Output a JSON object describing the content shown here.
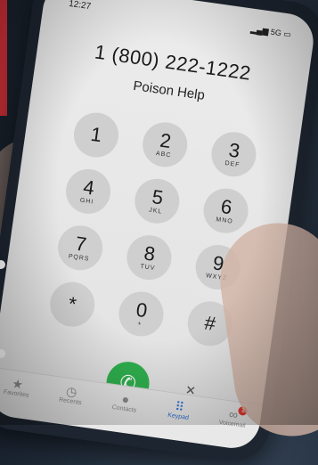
{
  "status": {
    "time": "12:27",
    "signal": "5G"
  },
  "dialer": {
    "number": "1 (800) 222-1222",
    "contact": "Poison Help",
    "keys": [
      {
        "digit": "1",
        "letters": ""
      },
      {
        "digit": "2",
        "letters": "ABC"
      },
      {
        "digit": "3",
        "letters": "DEF"
      },
      {
        "digit": "4",
        "letters": "GHI"
      },
      {
        "digit": "5",
        "letters": "JKL"
      },
      {
        "digit": "6",
        "letters": "MNO"
      },
      {
        "digit": "7",
        "letters": "PQRS"
      },
      {
        "digit": "8",
        "letters": "TUV"
      },
      {
        "digit": "9",
        "letters": "WXYZ"
      },
      {
        "digit": "*",
        "letters": ""
      },
      {
        "digit": "0",
        "letters": "+"
      },
      {
        "digit": "#",
        "letters": ""
      }
    ],
    "call_glyph": "✆",
    "delete_glyph": "✕"
  },
  "tabs": [
    {
      "label": "Favorites",
      "icon": "star-icon",
      "glyph": "★"
    },
    {
      "label": "Recents",
      "icon": "clock-icon",
      "glyph": "◷"
    },
    {
      "label": "Contacts",
      "icon": "person-icon",
      "glyph": "●"
    },
    {
      "label": "Keypad",
      "icon": "keypad-icon",
      "glyph": "⠿",
      "active": true
    },
    {
      "label": "Voicemail",
      "icon": "voicemail-icon",
      "glyph": "∞",
      "badge": "1"
    }
  ],
  "colors": {
    "accent": "#2a6fd6",
    "call_green": "#2fb04e",
    "badge_red": "#e0392f",
    "brand_red": "#d8323a"
  }
}
